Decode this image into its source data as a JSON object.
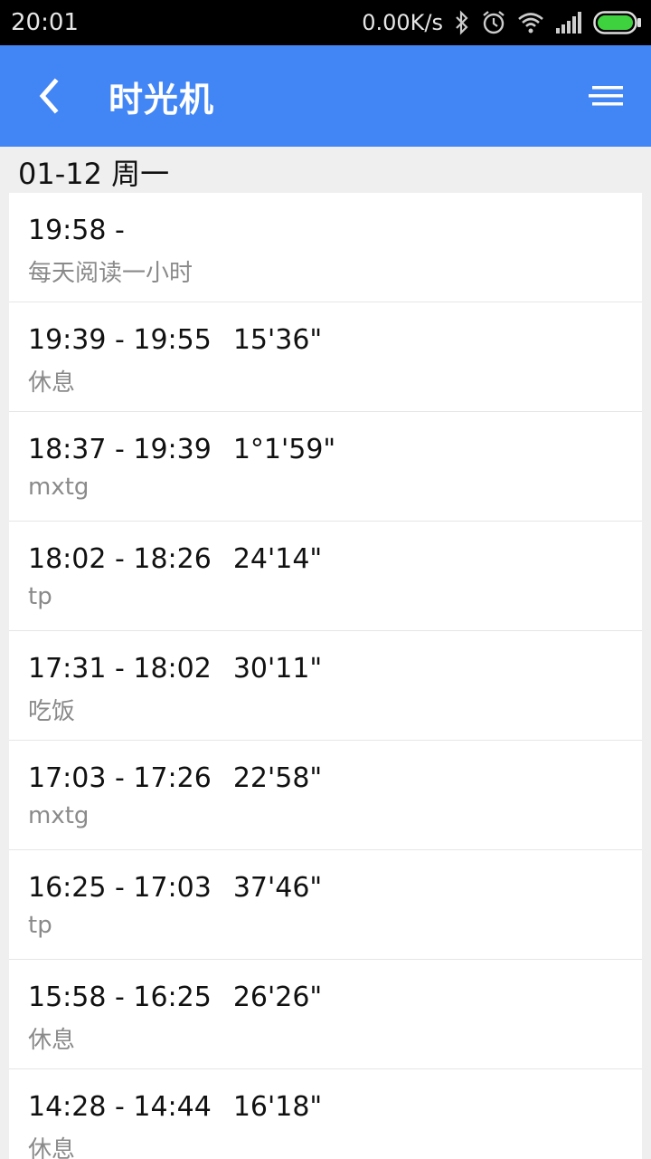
{
  "status_bar": {
    "time": "20:01",
    "net_speed": "0.00K/s",
    "icons": [
      "bluetooth-icon",
      "alarm-icon",
      "wifi-icon",
      "signal-icon",
      "battery-icon"
    ]
  },
  "app_bar": {
    "title": "时光机",
    "back_icon": "back-arrow-icon",
    "menu_icon": "sort-menu-icon",
    "color": "#4285f4"
  },
  "date_header": "01-12 周一",
  "entries": [
    {
      "time": "19:58 -",
      "duration": "",
      "label": "每天阅读一小时"
    },
    {
      "time": "19:39 - 19:55",
      "duration": "15'36\"",
      "label": "休息"
    },
    {
      "time": "18:37 - 19:39",
      "duration": "1°1'59\"",
      "label": "mxtg"
    },
    {
      "time": "18:02 - 18:26",
      "duration": "24'14\"",
      "label": "tp"
    },
    {
      "time": "17:31 - 18:02",
      "duration": "30'11\"",
      "label": "吃饭"
    },
    {
      "time": "17:03 - 17:26",
      "duration": "22'58\"",
      "label": "mxtg"
    },
    {
      "time": "16:25 - 17:03",
      "duration": "37'46\"",
      "label": "tp"
    },
    {
      "time": "15:58 - 16:25",
      "duration": "26'26\"",
      "label": "休息"
    },
    {
      "time": "14:28 - 14:44",
      "duration": "16'18\"",
      "label": "休息"
    }
  ]
}
